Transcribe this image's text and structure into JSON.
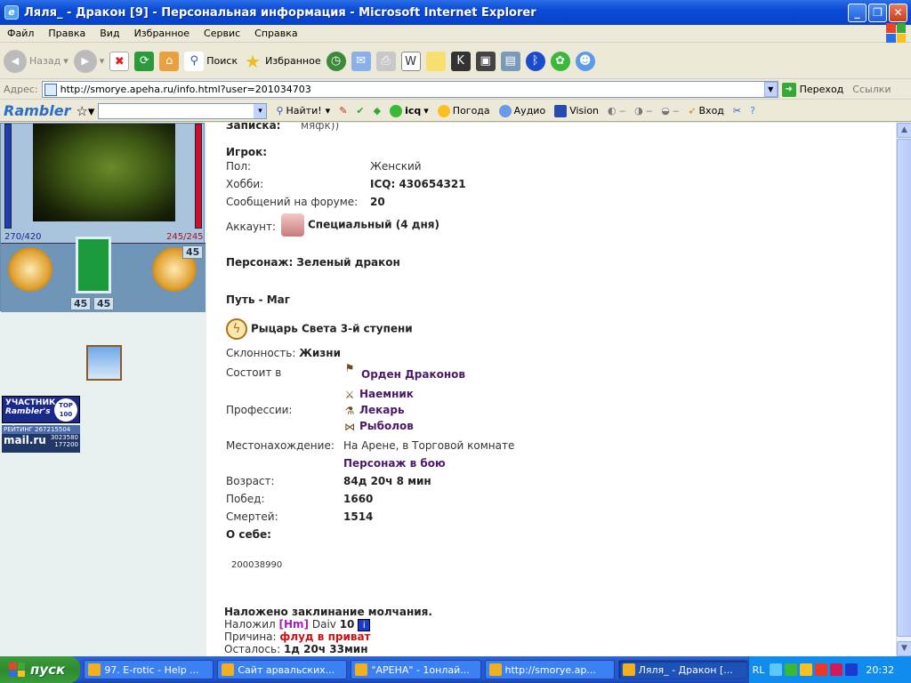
{
  "window": {
    "title": "Ляля_ - Дракон [9] - Персональная информация - Microsoft Internet Explorer",
    "min_symbol": "_",
    "max_symbol": "❐",
    "close_symbol": "✕"
  },
  "menu": [
    "Файл",
    "Правка",
    "Вид",
    "Избранное",
    "Сервис",
    "Справка"
  ],
  "toolbar": {
    "back": "Назад",
    "search": "Поиск",
    "favorites": "Избранное"
  },
  "address": {
    "label": "Адрес:",
    "url": "http://smorye.apeha.ru/info.html?user=201034703",
    "go": "Переход",
    "links": "Ссылки"
  },
  "rambler_bar": {
    "logo": "Rambler",
    "find": "Найти!",
    "icq": "icq",
    "weather": "Погода",
    "audio": "Аудио",
    "vision": "Vision",
    "login": "Вход"
  },
  "left": {
    "hp_left": "270/420",
    "hp_right": "245/245",
    "equip_values": [
      "45",
      "45",
      "45"
    ],
    "banner_top_line1": "УЧАСТНИК",
    "banner_top_line2": "Rambler's",
    "banner_top_badge": "TOP 100",
    "banner_mail_rating": "РЕЙТИНГ 267215504",
    "banner_mail_logo": "mail.ru",
    "banner_mail_n1": "3023580",
    "banner_mail_n2": "177200"
  },
  "profile": {
    "note_label": "Записка:",
    "note_value": "мяфк))",
    "player_heading": "Игрок:",
    "gender_label": "Пол:",
    "gender_value": "Женский",
    "hobby_label": "Хобби:",
    "hobby_value": "ICQ: 430654321",
    "posts_label": "Сообщений на форуме:",
    "posts_value": "20",
    "account_label": "Аккаунт:",
    "account_value": "Специальный (4 дня)",
    "character_heading": "Персонаж: Зеленый дракон",
    "path_heading": "Путь - Маг",
    "knight_rank": "Рыцарь Света 3-й ступени",
    "alignment_label": "Склонность:",
    "alignment_value": "Жизни",
    "member_label": "Состоит в",
    "member_value": "Орден Драконов",
    "professions_label": "Профессии:",
    "professions": [
      "Наемник",
      "Лекарь",
      "Рыболов"
    ],
    "location_label": "Местонахождение:",
    "location_value": "На Арене, в Торговой комнате",
    "in_battle": "Персонаж в бою",
    "age_label": "Возраст:",
    "age_value": "84д 20ч 8 мин",
    "wins_label": "Побед:",
    "wins_value": "1660",
    "deaths_label": "Смертей:",
    "deaths_value": "1514",
    "about_label": "О себе:",
    "about_value": "200038990",
    "silence_heading": "Наложено заклинание молчания.",
    "silence_by_label": "Наложил",
    "silence_by_clan": "[Hm]",
    "silence_by_name": "Daiv",
    "silence_by_level": "10",
    "silence_reason_label": "Причина:",
    "silence_reason": "флуд в приват",
    "silence_left_label": "Осталось:",
    "silence_left": "1д 20ч 33мин"
  },
  "taskbar": {
    "start": "пуск",
    "tasks": [
      "97. E-rotic - Help ...",
      "Сайт арвальских...",
      "\"АРЕНА\" - 1онлай...",
      "http://smorye.ap...",
      "Ляля_ - Дракон [..."
    ],
    "lang": "RL",
    "clock": "20:32"
  }
}
